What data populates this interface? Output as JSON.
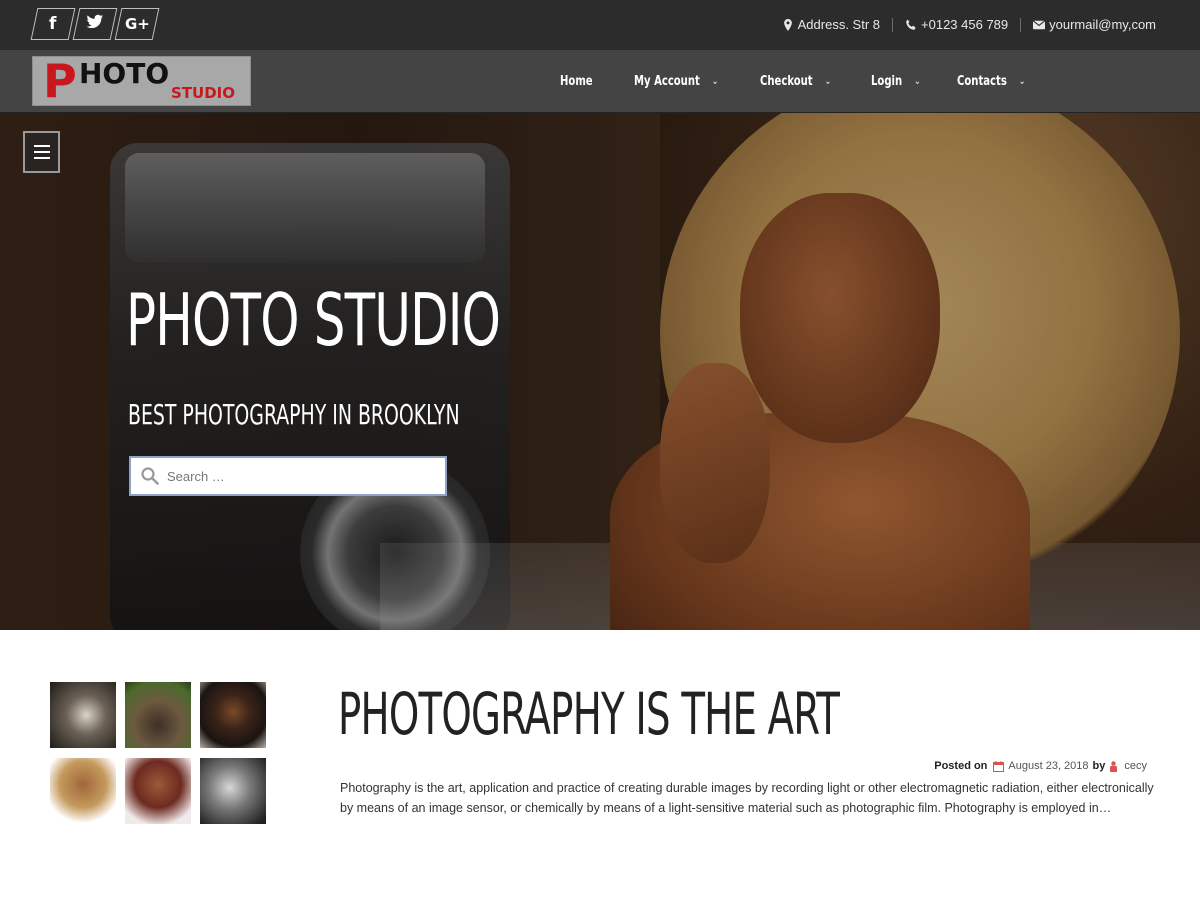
{
  "topbar": {
    "social": [
      {
        "name": "facebook",
        "glyph": "f"
      },
      {
        "name": "twitter",
        "glyph": "t"
      },
      {
        "name": "google-plus",
        "glyph": "G+"
      }
    ],
    "address": "Address. Str 8",
    "phone": "+0123 456 789",
    "email": "yourmail@my,com"
  },
  "logo": {
    "first_letter": "P",
    "rest": "HOTO",
    "sub": "STUDIO"
  },
  "nav": {
    "items": [
      {
        "label": "Home",
        "dropdown": false
      },
      {
        "label": "My Account",
        "dropdown": true
      },
      {
        "label": "Checkout",
        "dropdown": true
      },
      {
        "label": "Login",
        "dropdown": true
      },
      {
        "label": "Contacts",
        "dropdown": true
      }
    ]
  },
  "hero": {
    "title": "PHOTO STUDIO",
    "subtitle": "BEST PHOTOGRAPHY IN BROOKLYN",
    "search_placeholder": "Search …"
  },
  "post": {
    "title": "PHOTOGRAPHY IS THE ART",
    "posted_on_label": "Posted on",
    "date": "August 23, 2018",
    "by_label": "by",
    "author": "cecy",
    "excerpt": "Photography is the art, application and practice of creating durable images by recording light or other electromagnetic radiation, either electronically by means of an image sensor, or chemically by means of a light-sensitive material such as photographic film. Photography is employed in…"
  },
  "colors": {
    "accent_red": "#c8181e",
    "topbar_bg": "#2c2c2c",
    "navbar_bg": "#444444"
  }
}
